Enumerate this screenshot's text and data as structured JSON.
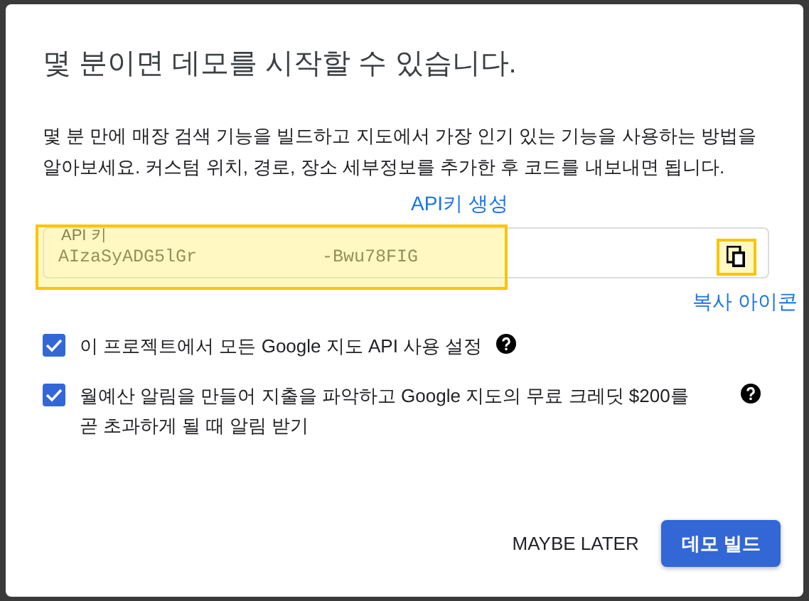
{
  "dialog": {
    "title": "몇 분이면 데모를 시작할 수 있습니다.",
    "description": "몇 분 만에 매장 검색 기능을 빌드하고 지도에서 가장 인기 있는 기능을 사용하는 방법을 알아보세요. 커스텀 위치, 경로, 장소 세부정보를 추가한 후 코드를 내보내면 됩니다.",
    "api_key_field": {
      "label": "API 키",
      "value_start": "AIzaSyADG5lGr",
      "value_end": "-Bwu78FIG",
      "highlighted": true,
      "annotation": "API키 생성"
    },
    "copy_button": {
      "highlighted": true,
      "annotation": "복사 아이콘"
    },
    "options": [
      {
        "label": "이 프로젝트에서 모든 Google 지도 API 사용 설정",
        "checked": true
      },
      {
        "label": "월예산 알림을 만들어 지출을 파악하고 Google 지도의 무료 크레딧 $200를 곧 초과하게 될 때 알림 받기",
        "checked": true
      }
    ],
    "buttons": [
      {
        "label": "MAYBE LATER",
        "kind": "text"
      },
      {
        "label": "데모 빌드",
        "kind": "primary"
      }
    ]
  }
}
